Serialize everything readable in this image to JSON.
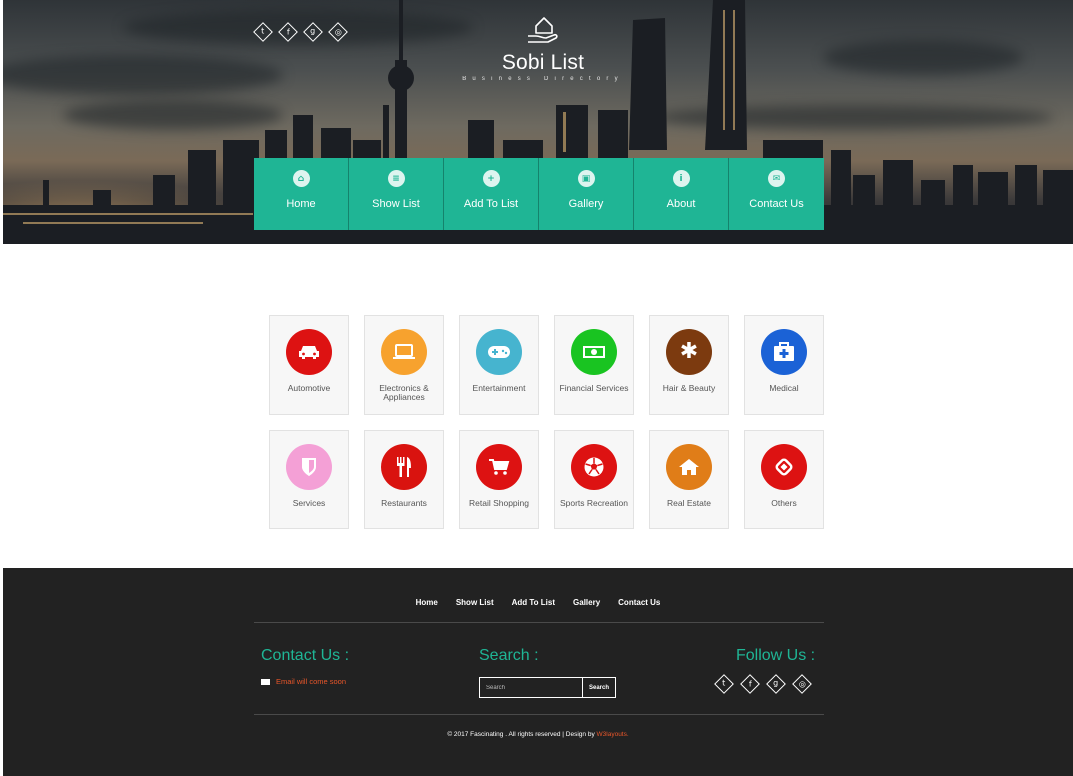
{
  "header": {
    "title": "Sobi List",
    "subtitle": "Business Directory",
    "social_icons": [
      "twitter-icon",
      "facebook-icon",
      "google-plus-icon",
      "dribbble-icon"
    ]
  },
  "nav": {
    "items": [
      {
        "label": "Home",
        "icon": "home-icon"
      },
      {
        "label": "Show List",
        "icon": "list-icon"
      },
      {
        "label": "Add To List",
        "icon": "plus-icon"
      },
      {
        "label": "Gallery",
        "icon": "picture-icon"
      },
      {
        "label": "About",
        "icon": "info-icon"
      },
      {
        "label": "Contact Us",
        "icon": "envelope-icon"
      }
    ]
  },
  "categories": [
    {
      "label": "Automotive",
      "icon": "car-icon",
      "color": "#dd1212"
    },
    {
      "label": "Electronics & Appliances",
      "icon": "laptop-icon",
      "color": "#f7a22e"
    },
    {
      "label": "Entertainment",
      "icon": "gamepad-icon",
      "color": "#46b4cf"
    },
    {
      "label": "Financial Services",
      "icon": "money-icon",
      "color": "#19c421"
    },
    {
      "label": "Hair & Beauty",
      "icon": "flower-icon",
      "color": "#7c3a0f"
    },
    {
      "label": "Medical",
      "icon": "medkit-icon",
      "color": "#1b62d6"
    },
    {
      "label": "Services",
      "icon": "shield-icon",
      "color": "#f4a0d6"
    },
    {
      "label": "Restaurants",
      "icon": "cutlery-icon",
      "color": "#d9130f"
    },
    {
      "label": "Retail Shopping",
      "icon": "cart-icon",
      "color": "#dd1212"
    },
    {
      "label": "Sports Recreation",
      "icon": "soccer-ball-icon",
      "color": "#dd1212"
    },
    {
      "label": "Real Estate",
      "icon": "house-icon",
      "color": "#e07d18"
    },
    {
      "label": "Others",
      "icon": "link-icon",
      "color": "#dd1212"
    }
  ],
  "footer": {
    "nav": [
      "Home",
      "Show List",
      "Add To List",
      "Gallery",
      "Contact Us"
    ],
    "contact_heading": "Contact Us :",
    "email_text": "Email will come soon",
    "search_heading": "Search :",
    "search_placeholder": "Search",
    "search_button": "Search",
    "follow_heading": "Follow Us :",
    "copyright": "© 2017 Fascinating . All rights reserved | Design by",
    "designer": "W3layouts."
  },
  "colors": {
    "accent": "#1fb595",
    "footer_bg": "#222222",
    "link_orange": "#e8562a"
  }
}
